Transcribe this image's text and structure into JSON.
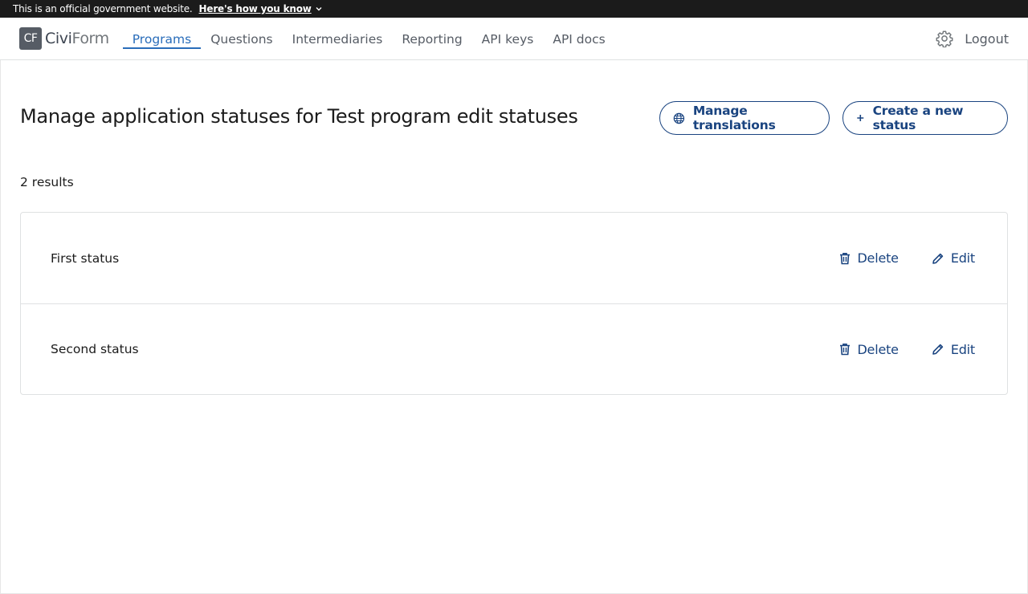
{
  "banner": {
    "text": "This is an official government website.",
    "link": "Here's how you know"
  },
  "logo": {
    "mark": "CF",
    "name_part1": "Civi",
    "name_part2": "Form"
  },
  "nav": {
    "items": [
      {
        "label": "Programs",
        "active": true
      },
      {
        "label": "Questions"
      },
      {
        "label": "Intermediaries"
      },
      {
        "label": "Reporting"
      },
      {
        "label": "API keys"
      },
      {
        "label": "API docs"
      }
    ],
    "logout": "Logout",
    "settings_icon": "gear-icon"
  },
  "page": {
    "title": "Manage application statuses for Test program edit statuses",
    "manage_translations": "Manage translations",
    "create_status": "Create a new status",
    "results": "2 results"
  },
  "statuses": [
    {
      "name": "First status",
      "delete": "Delete",
      "edit": "Edit"
    },
    {
      "name": "Second status",
      "delete": "Delete",
      "edit": "Edit"
    }
  ],
  "colors": {
    "banner_bg": "#1b1b1b",
    "accent": "#1a4480",
    "nav_active": "#2a6dba"
  }
}
